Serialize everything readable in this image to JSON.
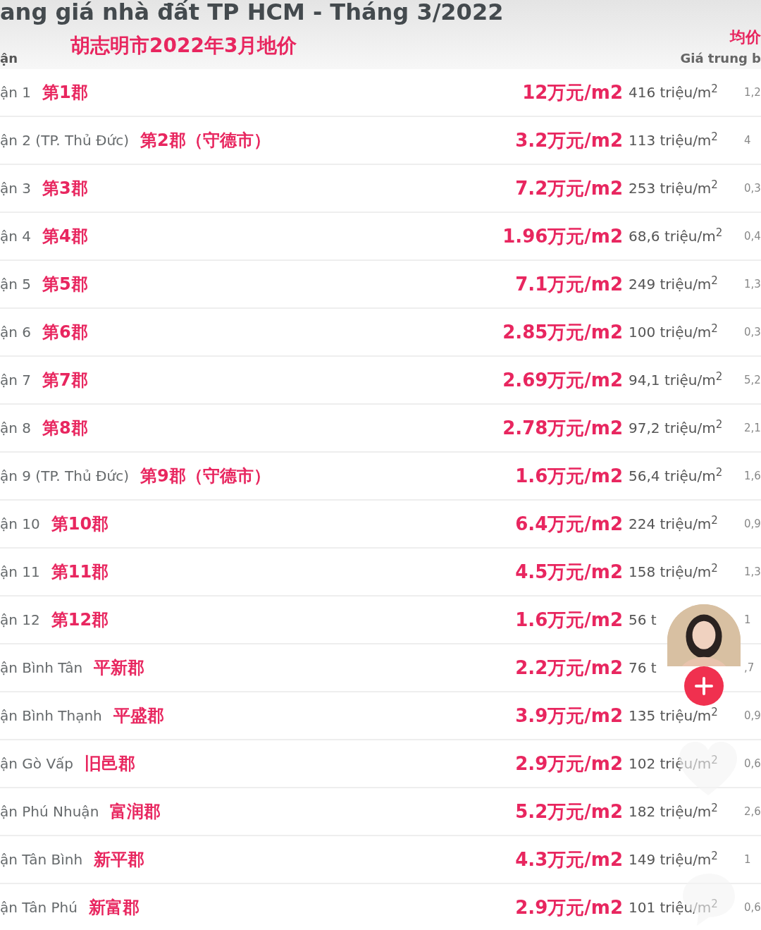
{
  "title": "ang giá nhà đất TP HCM - Tháng 3/2022",
  "subtitle": "胡志明市2022年3月地价",
  "header": {
    "district": "ận",
    "avg_cn": "均价",
    "avg_vn": "Giá trung b"
  },
  "rows": [
    {
      "vn": "ận 1",
      "cn": "第1郡",
      "price_cn": "12万元/m2",
      "price_vn": "416 triệu/m$^{2}$",
      "column_3": "1,2"
    },
    {
      "vn": "ận 2 (TP. Thủ Đức)",
      "cn": "第2郡（守德市）",
      "price_cn": "3.2万元/m2",
      "price_vn": "113 triệu/m$^{2}$",
      "column_3": "4"
    },
    {
      "vn": "ận 3",
      "cn": "第3郡",
      "price_cn": "7.2万元/m2",
      "price_vn": "253 triệu/m$^{2}$",
      "column_3": "0,3"
    },
    {
      "vn": "ận 4",
      "cn": "第4郡",
      "price_cn": "1.96万元/m2",
      "price_vn": "68,6 triệu/m$^{2}$",
      "column_3": "0,4"
    },
    {
      "vn": "ận 5",
      "cn": "第5郡",
      "price_cn": "7.1万元/m2",
      "price_vn": "249 triệu/m$^{2}$",
      "column_3": "1,3"
    },
    {
      "vn": "ận 6",
      "cn": "第6郡",
      "price_cn": "2.85万元/m2",
      "price_vn": "100 triệu/m$^{2}$",
      "column_3": "0,3"
    },
    {
      "vn": "ận 7",
      "cn": "第7郡",
      "price_cn": "2.69万元/m2",
      "price_vn": "94,1 triệu/m$^{2}$",
      "column_3": "5,2"
    },
    {
      "vn": "ận 8",
      "cn": "第8郡",
      "price_cn": "2.78万元/m2",
      "price_vn": "97,2 triệu/m$^{2}$",
      "column_3": "2,1"
    },
    {
      "vn": "ận 9 (TP. Thủ Đức)",
      "cn": "第9郡（守德市）",
      "price_cn": "1.6万元/m2",
      "price_vn": "56,4 triệu/m$^{2}$",
      "column_3": "1,6"
    },
    {
      "vn": "ận 10",
      "cn": "第10郡",
      "price_cn": "6.4万元/m2",
      "price_vn": "224 triệu/m$^{2}$",
      "column_3": "0,9"
    },
    {
      "vn": "ận 11",
      "cn": "第11郡",
      "price_cn": "4.5万元/m2",
      "price_vn": "158 triệu/m$^{2}$",
      "column_3": "1,3"
    },
    {
      "vn": "ận 12",
      "cn": "第12郡",
      "price_cn": "1.6万元/m2",
      "price_vn": "56 t",
      "column_3": "1"
    },
    {
      "vn": "ận Bình Tân",
      "cn": "平新郡",
      "price_cn": "2.2万元/m2",
      "price_vn": "76 t",
      "column_3": ",7"
    },
    {
      "vn": "ận Bình Thạnh",
      "cn": "平盛郡",
      "price_cn": "3.9万元/m2",
      "price_vn": "135 triệu/m$^{2}$",
      "column_3": "0,9"
    },
    {
      "vn": "ận Gò Vấp",
      "cn": "旧邑郡",
      "price_cn": "2.9万元/m2",
      "price_vn": "102 triệu/m$^{2}$",
      "column_3": "0,6"
    },
    {
      "vn": "ận Phú Nhuận",
      "cn": "富润郡",
      "price_cn": "5.2万元/m2",
      "price_vn": "182 triệu/m$^{2}$",
      "column_3": "2,6"
    },
    {
      "vn": "ận Tân Bình",
      "cn": "新平郡",
      "price_cn": "4.3万元/m2",
      "price_vn": "149 triệu/m$^{2}$",
      "column_3": "1"
    },
    {
      "vn": "ận Tân Phú",
      "cn": "新富郡",
      "price_cn": "2.9万元/m2",
      "price_vn": "101 triệu/m$^{2}$",
      "column_3": "0,6"
    }
  ]
}
